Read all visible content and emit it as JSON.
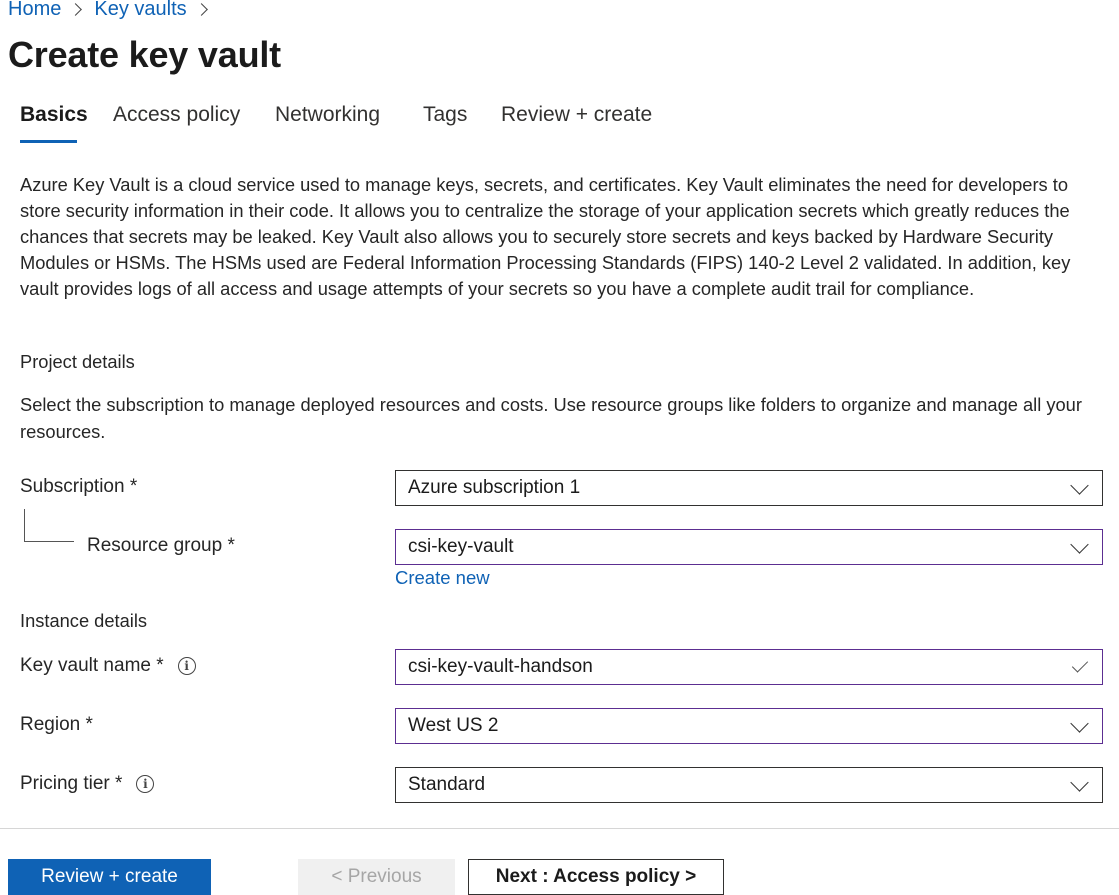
{
  "breadcrumb": {
    "items": [
      "Home",
      "Key vaults"
    ]
  },
  "page": {
    "title": "Create key vault"
  },
  "tabs": [
    "Basics",
    "Access policy",
    "Networking",
    "Tags",
    "Review + create"
  ],
  "description": "Azure Key Vault is a cloud service used to manage keys, secrets, and certificates. Key Vault eliminates the need for developers to store security information in their code. It allows you to centralize the storage of your application secrets which greatly reduces the chances that secrets may be leaked. Key Vault also allows you to securely store secrets and keys backed by Hardware Security Modules or HSMs. The HSMs used are Federal Information Processing Standards (FIPS) 140-2 Level 2 validated. In addition, key vault provides logs of all access and usage attempts of your secrets so you have a complete audit trail for compliance.",
  "project": {
    "heading": "Project details",
    "help": "Select the subscription to manage deployed resources and costs. Use resource groups like folders to organize and manage all your resources."
  },
  "fields": {
    "subscription": {
      "label": "Subscription *",
      "value": "Azure subscription 1"
    },
    "resource_group": {
      "label": "Resource group *",
      "value": "csi-key-vault",
      "create_new": "Create new"
    },
    "key_vault_name": {
      "label": "Key vault name *",
      "value": "csi-key-vault-handson",
      "valid": true
    },
    "region": {
      "label": "Region *",
      "value": "West US 2"
    },
    "pricing_tier": {
      "label": "Pricing tier *",
      "value": "Standard"
    }
  },
  "instance": {
    "heading": "Instance details"
  },
  "info_glyph": "i",
  "footer": {
    "review_create": "Review + create",
    "previous": "< Previous",
    "next": "Next : Access policy >"
  },
  "colors": {
    "accent": "#0f62b5",
    "focus_border": "#5c2e91"
  }
}
